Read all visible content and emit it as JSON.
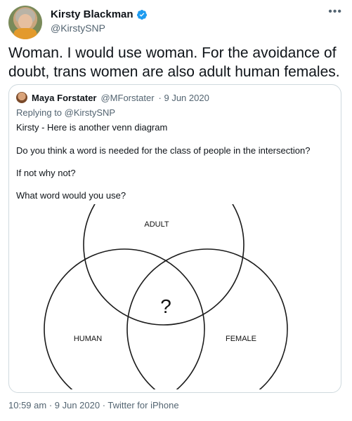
{
  "author": {
    "name": "Kirsty Blackman",
    "handle": "@KirstySNP"
  },
  "tweet": {
    "text": "Woman. I would use woman. For the avoidance of doubt, trans women are also adult human females."
  },
  "quoted": {
    "author_name": "Maya Forstater",
    "author_handle": "@MForstater",
    "date": "· 9 Jun 2020",
    "replying_prefix": "Replying to",
    "replying_handle": "@KirstySNP",
    "lines": [
      "Kirsty - Here is another venn diagram",
      "Do you think a word is needed for the class of people in the intersection?",
      "If not why not?",
      "What word would you use?"
    ],
    "venn": {
      "label_top": "ADULT",
      "label_left": "HUMAN",
      "label_right": "FEMALE",
      "center": "?"
    }
  },
  "footer": {
    "meta": "10:59 am · 9 Jun 2020 · Twitter for iPhone"
  },
  "colors": {
    "verified": "#1d9bf0",
    "secondary_text": "#536471",
    "border": "#cfd9de"
  },
  "icons": {
    "verified": "verified-badge-icon",
    "more": "more-options-icon"
  }
}
